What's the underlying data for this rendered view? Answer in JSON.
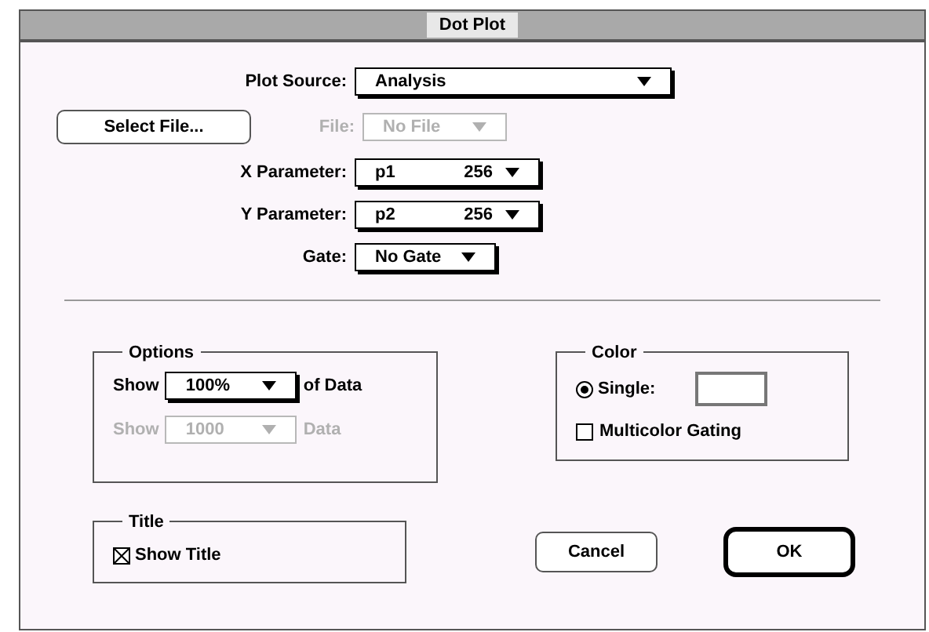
{
  "window": {
    "title": "Dot Plot"
  },
  "plot_source": {
    "label": "Plot Source:",
    "value": "Analysis",
    "disabled": false
  },
  "select_file_button": {
    "label": "Select File..."
  },
  "file": {
    "label": "File:",
    "value": "No File",
    "disabled": true
  },
  "parameters": [
    {
      "label": "X Parameter:",
      "value": "p1",
      "resolution": "256",
      "disabled": false
    },
    {
      "label": "Y Parameter:",
      "value": "p2",
      "resolution": "256",
      "disabled": false
    }
  ],
  "gate": {
    "label": "Gate:",
    "value": "No Gate",
    "disabled": false
  },
  "options": {
    "title": "Options",
    "rows": [
      {
        "label": "Show",
        "value": "100%",
        "suffix": "of Data",
        "disabled": false
      },
      {
        "label": "Show",
        "value": "1000",
        "suffix": "Data",
        "disabled": true
      }
    ]
  },
  "color": {
    "title": "Color",
    "single": {
      "label": "Single:",
      "selected": true
    },
    "multicolor": {
      "label": "Multicolor Gating",
      "checked": false
    }
  },
  "title_group": {
    "title": "Title",
    "show_title": {
      "label": "Show Title",
      "checked": true
    }
  },
  "buttons": [
    {
      "label": "Cancel",
      "default": false
    },
    {
      "label": "OK",
      "default": true
    }
  ]
}
